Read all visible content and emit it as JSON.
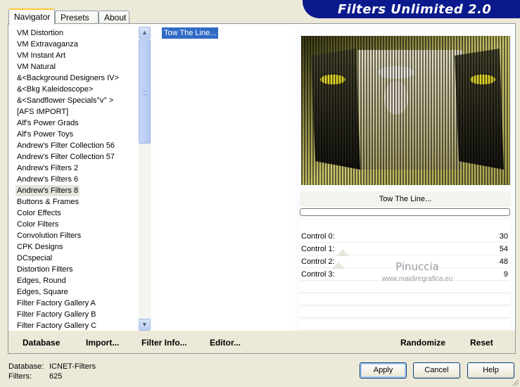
{
  "tabs": [
    "Navigator",
    "Presets",
    "About"
  ],
  "title": "Filters Unlimited 2.0",
  "categories": [
    "VM Distortion",
    "VM Extravaganza",
    "VM Instant Art",
    "VM Natural",
    "&<Background Designers IV>",
    "&<Bkg Kaleidoscope>",
    "&<Sandflower Specials°v° >",
    "[AFS IMPORT]",
    "Alf's Power Grads",
    "Alf's Power Toys",
    "Andrew's Filter Collection 56",
    "Andrew's Filter Collection 57",
    "Andrew's Filters 2",
    "Andrew's Filters 6",
    "Andrew's Filters 8",
    "Buttons & Frames",
    "Color Effects",
    "Color Filters",
    "Convolution Filters",
    "CPK Designs",
    "DCspecial",
    "Distortion Filters",
    "Edges, Round",
    "Edges, Square",
    "Filter Factory Gallery A",
    "Filter Factory Gallery B",
    "Filter Factory Gallery C"
  ],
  "selected_category": "Andrew's Filters 8",
  "filters": [
    "Tow The Line..."
  ],
  "selected_filter_name": "Tow The Line...",
  "controls": [
    {
      "label": "Control 0:",
      "value": "30"
    },
    {
      "label": "Control 1:",
      "value": "54"
    },
    {
      "label": "Control 2:",
      "value": "48"
    },
    {
      "label": "Control 3:",
      "value": "9"
    }
  ],
  "watermark": {
    "line1": "Pinuccia",
    "line2": "www.maidiregrafica.eu"
  },
  "bottom_links": {
    "database": "Database",
    "import": "Import...",
    "filter_info": "Filter Info...",
    "editor": "Editor...",
    "randomize": "Randomize",
    "reset": "Reset"
  },
  "status": {
    "database_label": "Database:",
    "database_value": "ICNET-Filters",
    "filters_label": "Filters:",
    "filters_value": "625"
  },
  "buttons": {
    "apply": "Apply",
    "cancel": "Cancel",
    "help": "Help"
  },
  "colors": {
    "banner": "#0a1a8c",
    "selection": "#316ac5",
    "preview_accent": "#c8c800"
  }
}
